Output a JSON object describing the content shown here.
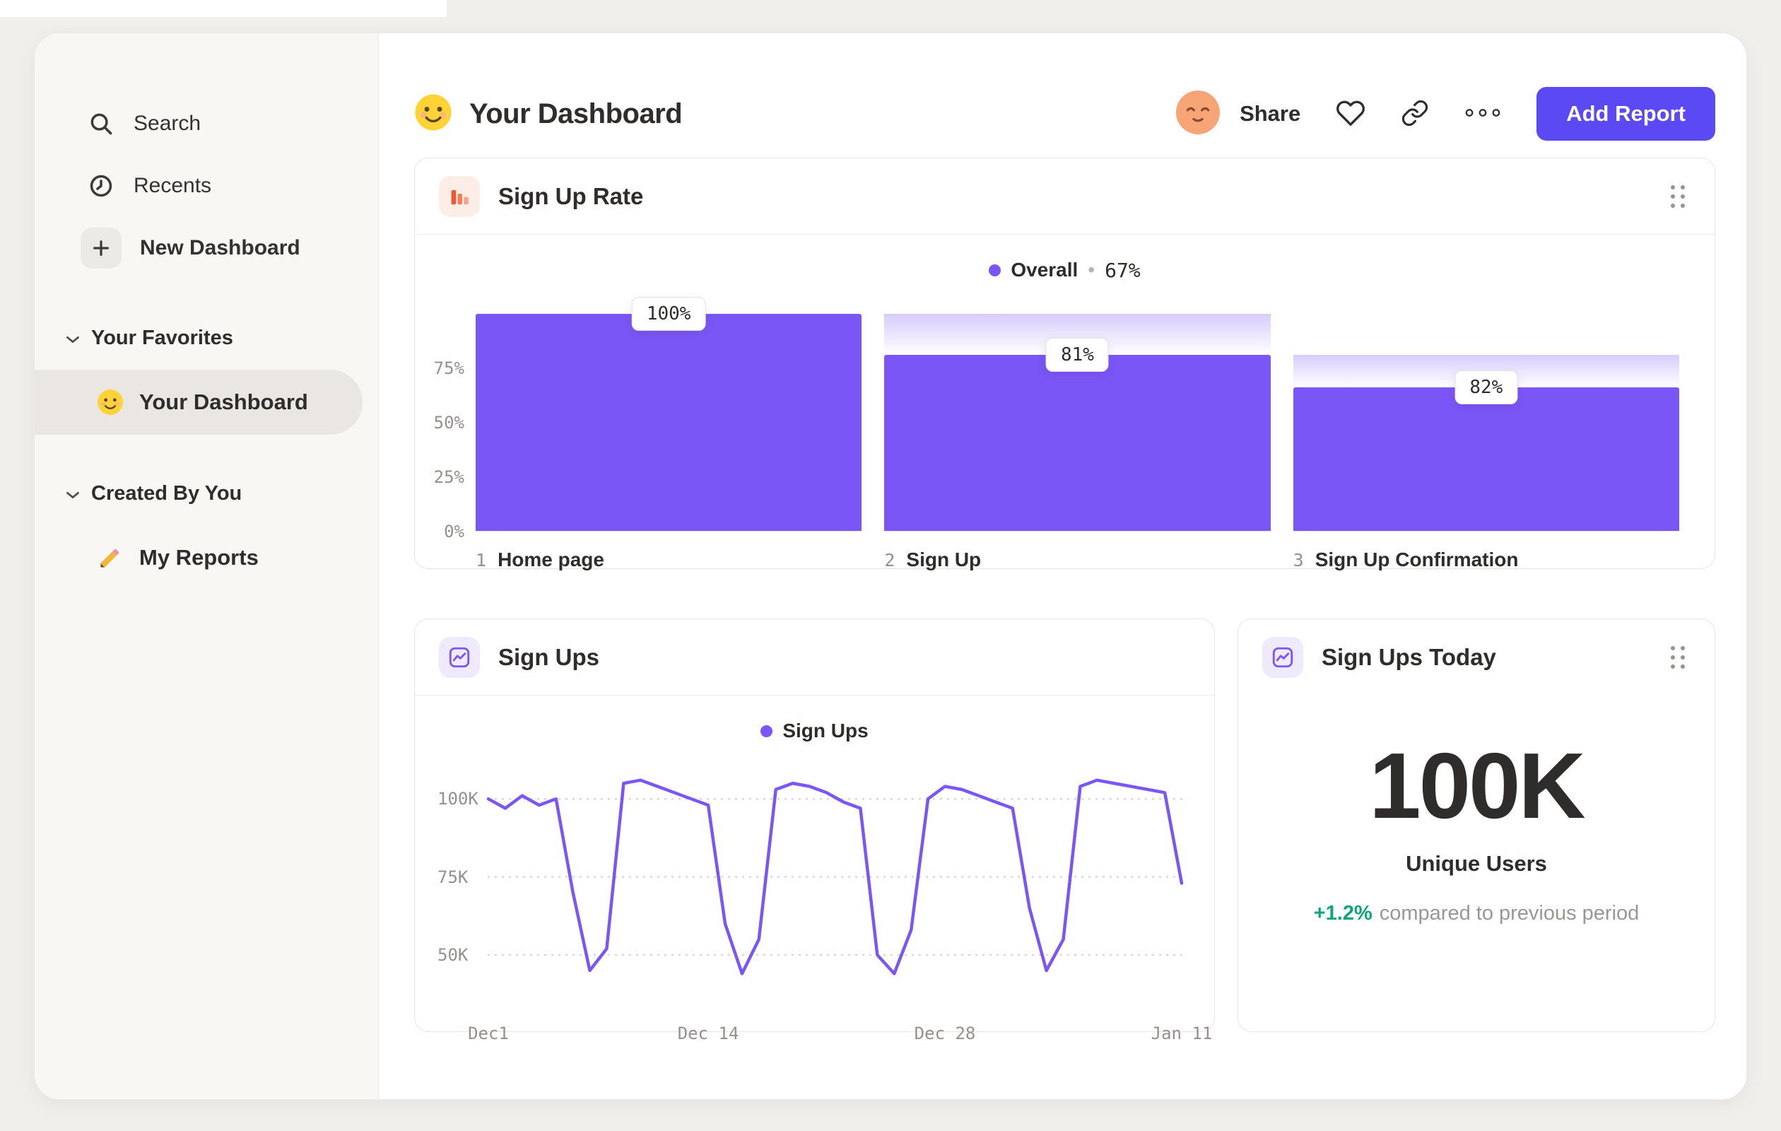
{
  "header": {
    "title": "Your Dashboard",
    "share_label": "Share",
    "add_report_label": "Add Report"
  },
  "sidebar": {
    "items": [
      {
        "label": "Search",
        "icon": "search-icon"
      },
      {
        "label": "Recents",
        "icon": "clock-icon"
      },
      {
        "label": "New Dashboard",
        "icon": "plus-icon"
      }
    ],
    "sections": [
      {
        "title": "Your Favorites",
        "items": [
          {
            "label": "Your Dashboard",
            "icon": "smiley-icon",
            "selected": true
          }
        ]
      },
      {
        "title": "Created By You",
        "items": [
          {
            "label": "My Reports",
            "icon": "pencil-icon",
            "selected": false
          }
        ]
      }
    ]
  },
  "cards": {
    "funnel": {
      "title": "Sign Up Rate",
      "legend": {
        "label": "Overall",
        "separator": "•",
        "value": "67%"
      }
    },
    "line": {
      "title": "Sign Ups",
      "legend_label": "Sign Ups"
    },
    "kpi": {
      "title": "Sign Ups Today",
      "value": "100K",
      "metric": "Unique Users",
      "delta": "+1.2%",
      "delta_note": "compared to previous period"
    }
  },
  "colors": {
    "accent_purple": "#7b56f6",
    "button_indigo": "#5b49f3",
    "icon_orange": "#f1562f",
    "delta_green": "#0ba57d"
  },
  "chart_data": [
    {
      "type": "bar",
      "subtype": "funnel",
      "title": "Sign Up Rate",
      "overall_conversion": "67%",
      "y_ticks": [
        {
          "label": "75%",
          "value": 75
        },
        {
          "label": "50%",
          "value": 50
        },
        {
          "label": "25%",
          "value": 25
        },
        {
          "label": "0%",
          "value": 0
        }
      ],
      "steps": [
        {
          "index": 1,
          "label": "Home page",
          "conversion": 100,
          "cumulative": 100
        },
        {
          "index": 2,
          "label": "Sign Up",
          "conversion": 81,
          "cumulative": 81
        },
        {
          "index": 3,
          "label": "Sign Up Confirmation",
          "conversion": 82,
          "cumulative": 66
        }
      ]
    },
    {
      "type": "line",
      "title": "Sign Ups",
      "ylim": [
        33,
        110
      ],
      "unit": "K",
      "y_ticks": [
        {
          "label": "100K",
          "value": 100
        },
        {
          "label": "75K",
          "value": 75
        },
        {
          "label": "50K",
          "value": 50
        }
      ],
      "x_ticks": [
        {
          "label": "Dec1",
          "day": 0
        },
        {
          "label": "Dec 14",
          "day": 13
        },
        {
          "label": "Dec 28",
          "day": 27
        },
        {
          "label": "Jan 11",
          "day": 41
        }
      ],
      "series": [
        {
          "name": "Sign Ups",
          "values": [
            100,
            97,
            101,
            98,
            100,
            70,
            45,
            52,
            105,
            106,
            104,
            102,
            100,
            98,
            60,
            44,
            55,
            103,
            105,
            104,
            102,
            99,
            97,
            50,
            44,
            58,
            100,
            104,
            103,
            101,
            99,
            97,
            65,
            45,
            55,
            104,
            106,
            105,
            104,
            103,
            102,
            73
          ]
        }
      ]
    },
    {
      "type": "kpi",
      "title": "Sign Ups Today",
      "value": "100K",
      "metric": "Unique Users",
      "change": "+1.2%",
      "change_note": "compared to previous period"
    }
  ]
}
